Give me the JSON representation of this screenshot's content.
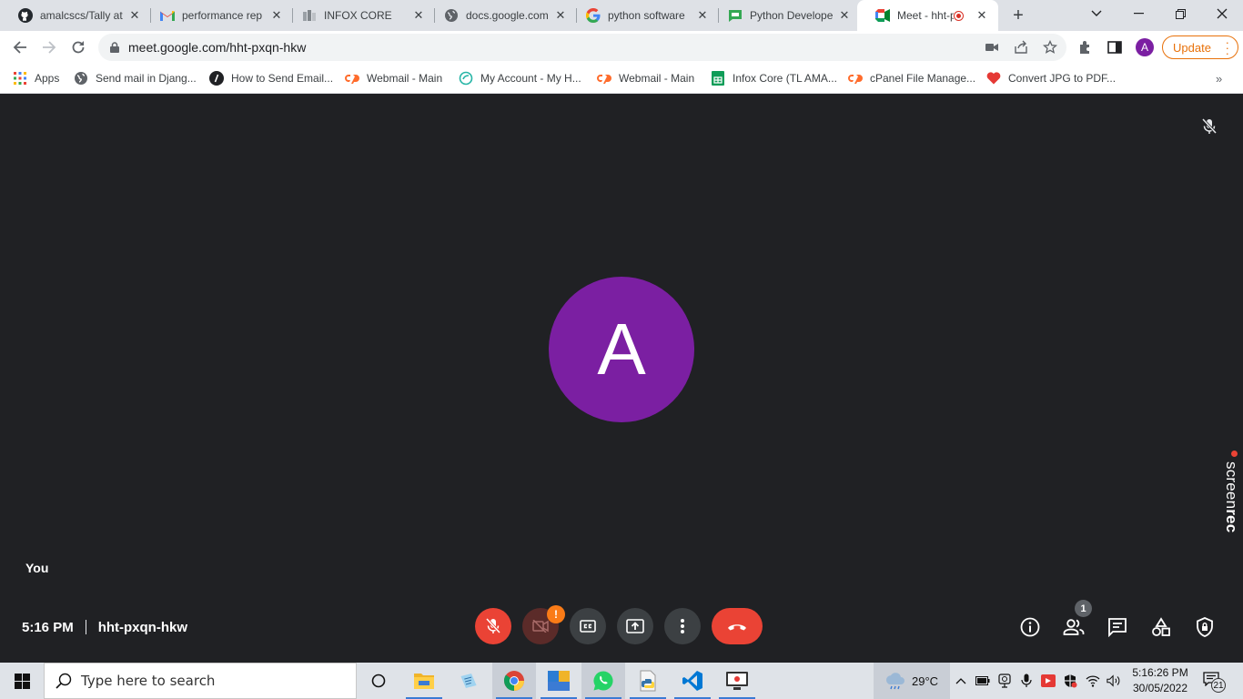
{
  "browser": {
    "tabs": [
      {
        "title": "amalcscs/Tally at",
        "icon": "github-icon"
      },
      {
        "title": "performance rep",
        "icon": "gmail-icon"
      },
      {
        "title": "INFOX CORE",
        "icon": "infox-icon"
      },
      {
        "title": "docs.google.com",
        "icon": "globe-icon"
      },
      {
        "title": "python software",
        "icon": "google-icon"
      },
      {
        "title": "Python Develope",
        "icon": "chat-icon"
      },
      {
        "title": "Meet - hht-p",
        "icon": "google-meet-icon",
        "active": true,
        "recording": true
      }
    ],
    "url": "meet.google.com/hht-pxqn-hkw",
    "profile_initial": "A",
    "update_label": "Update",
    "bookmarks": [
      {
        "label": "Apps",
        "icon": "apps-grid-icon"
      },
      {
        "label": "Send mail in Djang...",
        "icon": "globe-icon"
      },
      {
        "label": "How to Send Email...",
        "icon": "code-icon"
      },
      {
        "label": "Webmail - Main",
        "icon": "cpanel-icon"
      },
      {
        "label": "My Account - My H...",
        "icon": "hostinger-icon"
      },
      {
        "label": "Webmail - Main",
        "icon": "cpanel-icon"
      },
      {
        "label": "Infox Core (TL AMA...",
        "icon": "sheets-icon"
      },
      {
        "label": "cPanel File Manage...",
        "icon": "cpanel-icon"
      },
      {
        "label": "Convert JPG to PDF...",
        "icon": "heart-icon"
      }
    ]
  },
  "meet": {
    "avatar_initial": "A",
    "avatar_color": "#7b1fa2",
    "self_label": "You",
    "time": "5:16 PM",
    "meeting_code": "hht-pxqn-hkw",
    "camera_warning": "!",
    "people_count": "1",
    "watermark_brand": "screenrec"
  },
  "taskbar": {
    "search_placeholder": "Type here to search",
    "temperature": "29°C",
    "clock_time": "5:16:26 PM",
    "clock_date": "30/05/2022",
    "notification_count": "21"
  }
}
